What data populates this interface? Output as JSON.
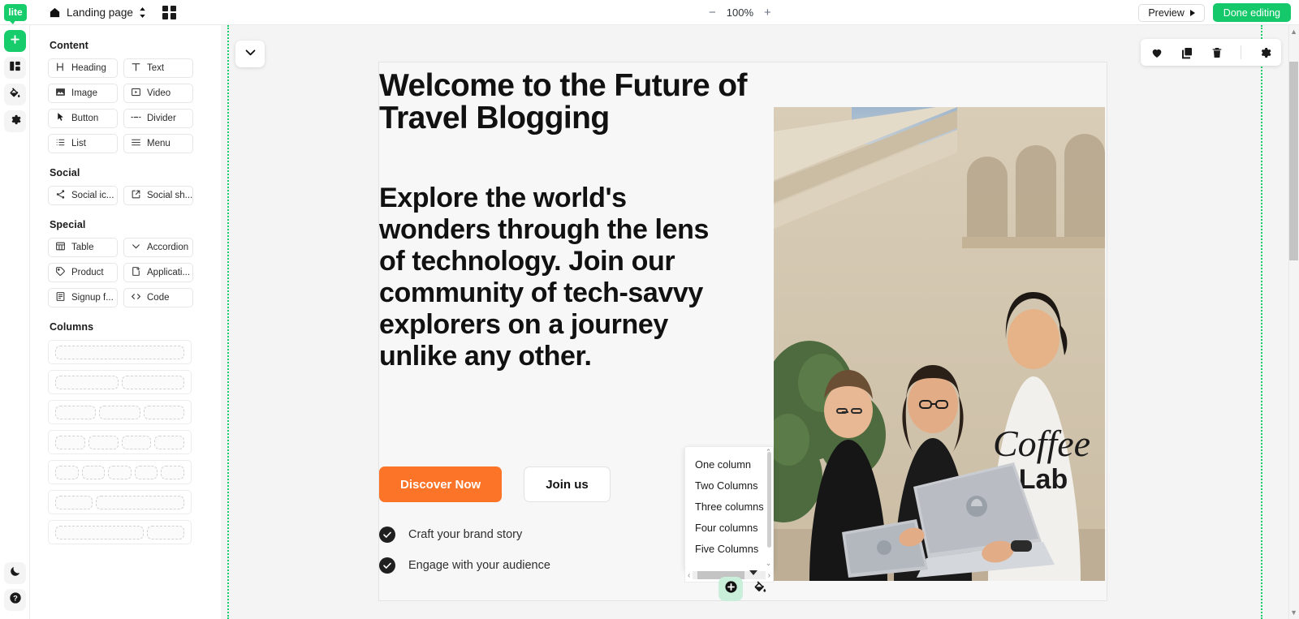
{
  "topbar": {
    "logo_text": "lite",
    "page_name": "Landing page",
    "zoom_minus": "−",
    "zoom_value": "100%",
    "zoom_plus": "+",
    "preview_label": "Preview",
    "done_label": "Done editing"
  },
  "rail": {
    "items": [
      {
        "name": "add-block",
        "icon": "plus-icon",
        "active": true
      },
      {
        "name": "layout",
        "icon": "layout-icon",
        "active": false
      },
      {
        "name": "theme",
        "icon": "paint-bucket-icon",
        "active": false
      },
      {
        "name": "settings",
        "icon": "gear-icon",
        "active": false
      }
    ],
    "bottom": [
      {
        "name": "dark-mode",
        "icon": "moon-icon"
      },
      {
        "name": "help",
        "icon": "question-icon"
      }
    ]
  },
  "panel": {
    "sections": [
      {
        "title": "Content",
        "blocks": [
          {
            "label": "Heading",
            "icon": "heading-icon"
          },
          {
            "label": "Text",
            "icon": "text-icon"
          },
          {
            "label": "Image",
            "icon": "image-icon"
          },
          {
            "label": "Video",
            "icon": "video-icon"
          },
          {
            "label": "Button",
            "icon": "cursor-icon"
          },
          {
            "label": "Divider",
            "icon": "divider-icon"
          },
          {
            "label": "List",
            "icon": "list-icon"
          },
          {
            "label": "Menu",
            "icon": "menu-icon"
          }
        ]
      },
      {
        "title": "Social",
        "blocks": [
          {
            "label": "Social ic...",
            "icon": "share-nodes-icon"
          },
          {
            "label": "Social sh...",
            "icon": "external-link-icon"
          }
        ]
      },
      {
        "title": "Special",
        "blocks": [
          {
            "label": "Table",
            "icon": "table-icon"
          },
          {
            "label": "Accordion",
            "icon": "chevron-down-icon"
          },
          {
            "label": "Product",
            "icon": "tag-icon"
          },
          {
            "label": "Applicati...",
            "icon": "application-icon"
          },
          {
            "label": "Signup f...",
            "icon": "form-icon"
          },
          {
            "label": "Code",
            "icon": "code-icon"
          }
        ]
      }
    ],
    "columns_title": "Columns",
    "columns": [
      {
        "name": "one-column",
        "cells": [
          1
        ]
      },
      {
        "name": "two-columns",
        "cells": [
          1,
          1
        ]
      },
      {
        "name": "three-columns",
        "cells": [
          1,
          1,
          1
        ]
      },
      {
        "name": "four-columns",
        "cells": [
          1,
          1,
          1,
          1
        ]
      },
      {
        "name": "five-columns",
        "cells": [
          1,
          1,
          1,
          1,
          1
        ]
      },
      {
        "name": "one-third-two-thirds",
        "cells": [
          1,
          2.4
        ]
      },
      {
        "name": "two-thirds-one-third",
        "cells": [
          2.4,
          1
        ]
      }
    ]
  },
  "canvas": {
    "collapse_icon": "chevron-down-icon",
    "block_toolbar": [
      {
        "name": "favorite",
        "icon": "heart-icon"
      },
      {
        "name": "duplicate",
        "icon": "copy-icon"
      },
      {
        "name": "delete",
        "icon": "trash-icon"
      },
      {
        "name": "settings",
        "icon": "gear-icon"
      }
    ],
    "hero": {
      "heading": "Welcome to the Future of Travel Blogging",
      "subheading": "Explore the world's wonders through the lens of technology. Join our community of tech-savvy explorers on a journey unlike any other.",
      "primary_cta": "Discover Now",
      "secondary_cta": "Join us",
      "features": [
        "Craft your brand story",
        "Engage with your audience"
      ],
      "image_alt": "three people looking at a laptop outdoors"
    },
    "dropdown": {
      "items": [
        "One column",
        "Two Columns",
        "Three columns",
        "Four columns",
        "Five Columns"
      ],
      "scroll_up": "⌃",
      "scroll_down": "⌄",
      "scroll_left": "‹",
      "scroll_right": "›"
    },
    "fabs": [
      {
        "name": "add-block-fab",
        "icon": "plus-circle-icon"
      },
      {
        "name": "style-fab",
        "icon": "paint-bucket-icon"
      }
    ]
  },
  "colors": {
    "brand_green": "#17cc6a",
    "cta_orange": "#fc7427",
    "canvas_bg": "#f4f4f4"
  }
}
